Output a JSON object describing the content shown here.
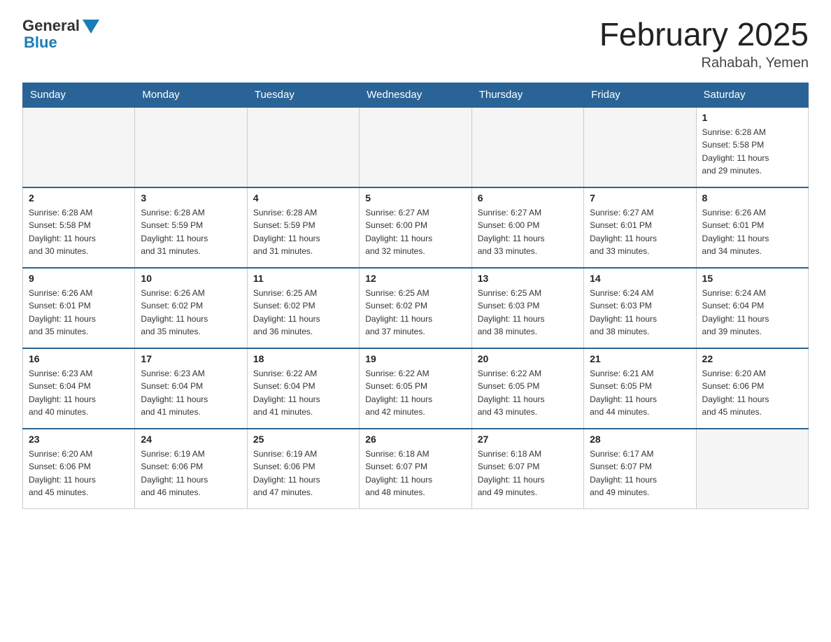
{
  "logo": {
    "general": "General",
    "blue": "Blue"
  },
  "title": "February 2025",
  "subtitle": "Rahabah, Yemen",
  "days_of_week": [
    "Sunday",
    "Monday",
    "Tuesday",
    "Wednesday",
    "Thursday",
    "Friday",
    "Saturday"
  ],
  "weeks": [
    [
      {
        "day": "",
        "info": "",
        "empty": true
      },
      {
        "day": "",
        "info": "",
        "empty": true
      },
      {
        "day": "",
        "info": "",
        "empty": true
      },
      {
        "day": "",
        "info": "",
        "empty": true
      },
      {
        "day": "",
        "info": "",
        "empty": true
      },
      {
        "day": "",
        "info": "",
        "empty": true
      },
      {
        "day": "1",
        "info": "Sunrise: 6:28 AM\nSunset: 5:58 PM\nDaylight: 11 hours\nand 29 minutes.",
        "empty": false
      }
    ],
    [
      {
        "day": "2",
        "info": "Sunrise: 6:28 AM\nSunset: 5:58 PM\nDaylight: 11 hours\nand 30 minutes.",
        "empty": false
      },
      {
        "day": "3",
        "info": "Sunrise: 6:28 AM\nSunset: 5:59 PM\nDaylight: 11 hours\nand 31 minutes.",
        "empty": false
      },
      {
        "day": "4",
        "info": "Sunrise: 6:28 AM\nSunset: 5:59 PM\nDaylight: 11 hours\nand 31 minutes.",
        "empty": false
      },
      {
        "day": "5",
        "info": "Sunrise: 6:27 AM\nSunset: 6:00 PM\nDaylight: 11 hours\nand 32 minutes.",
        "empty": false
      },
      {
        "day": "6",
        "info": "Sunrise: 6:27 AM\nSunset: 6:00 PM\nDaylight: 11 hours\nand 33 minutes.",
        "empty": false
      },
      {
        "day": "7",
        "info": "Sunrise: 6:27 AM\nSunset: 6:01 PM\nDaylight: 11 hours\nand 33 minutes.",
        "empty": false
      },
      {
        "day": "8",
        "info": "Sunrise: 6:26 AM\nSunset: 6:01 PM\nDaylight: 11 hours\nand 34 minutes.",
        "empty": false
      }
    ],
    [
      {
        "day": "9",
        "info": "Sunrise: 6:26 AM\nSunset: 6:01 PM\nDaylight: 11 hours\nand 35 minutes.",
        "empty": false
      },
      {
        "day": "10",
        "info": "Sunrise: 6:26 AM\nSunset: 6:02 PM\nDaylight: 11 hours\nand 35 minutes.",
        "empty": false
      },
      {
        "day": "11",
        "info": "Sunrise: 6:25 AM\nSunset: 6:02 PM\nDaylight: 11 hours\nand 36 minutes.",
        "empty": false
      },
      {
        "day": "12",
        "info": "Sunrise: 6:25 AM\nSunset: 6:02 PM\nDaylight: 11 hours\nand 37 minutes.",
        "empty": false
      },
      {
        "day": "13",
        "info": "Sunrise: 6:25 AM\nSunset: 6:03 PM\nDaylight: 11 hours\nand 38 minutes.",
        "empty": false
      },
      {
        "day": "14",
        "info": "Sunrise: 6:24 AM\nSunset: 6:03 PM\nDaylight: 11 hours\nand 38 minutes.",
        "empty": false
      },
      {
        "day": "15",
        "info": "Sunrise: 6:24 AM\nSunset: 6:04 PM\nDaylight: 11 hours\nand 39 minutes.",
        "empty": false
      }
    ],
    [
      {
        "day": "16",
        "info": "Sunrise: 6:23 AM\nSunset: 6:04 PM\nDaylight: 11 hours\nand 40 minutes.",
        "empty": false
      },
      {
        "day": "17",
        "info": "Sunrise: 6:23 AM\nSunset: 6:04 PM\nDaylight: 11 hours\nand 41 minutes.",
        "empty": false
      },
      {
        "day": "18",
        "info": "Sunrise: 6:22 AM\nSunset: 6:04 PM\nDaylight: 11 hours\nand 41 minutes.",
        "empty": false
      },
      {
        "day": "19",
        "info": "Sunrise: 6:22 AM\nSunset: 6:05 PM\nDaylight: 11 hours\nand 42 minutes.",
        "empty": false
      },
      {
        "day": "20",
        "info": "Sunrise: 6:22 AM\nSunset: 6:05 PM\nDaylight: 11 hours\nand 43 minutes.",
        "empty": false
      },
      {
        "day": "21",
        "info": "Sunrise: 6:21 AM\nSunset: 6:05 PM\nDaylight: 11 hours\nand 44 minutes.",
        "empty": false
      },
      {
        "day": "22",
        "info": "Sunrise: 6:20 AM\nSunset: 6:06 PM\nDaylight: 11 hours\nand 45 minutes.",
        "empty": false
      }
    ],
    [
      {
        "day": "23",
        "info": "Sunrise: 6:20 AM\nSunset: 6:06 PM\nDaylight: 11 hours\nand 45 minutes.",
        "empty": false
      },
      {
        "day": "24",
        "info": "Sunrise: 6:19 AM\nSunset: 6:06 PM\nDaylight: 11 hours\nand 46 minutes.",
        "empty": false
      },
      {
        "day": "25",
        "info": "Sunrise: 6:19 AM\nSunset: 6:06 PM\nDaylight: 11 hours\nand 47 minutes.",
        "empty": false
      },
      {
        "day": "26",
        "info": "Sunrise: 6:18 AM\nSunset: 6:07 PM\nDaylight: 11 hours\nand 48 minutes.",
        "empty": false
      },
      {
        "day": "27",
        "info": "Sunrise: 6:18 AM\nSunset: 6:07 PM\nDaylight: 11 hours\nand 49 minutes.",
        "empty": false
      },
      {
        "day": "28",
        "info": "Sunrise: 6:17 AM\nSunset: 6:07 PM\nDaylight: 11 hours\nand 49 minutes.",
        "empty": false
      },
      {
        "day": "",
        "info": "",
        "empty": true
      }
    ]
  ]
}
